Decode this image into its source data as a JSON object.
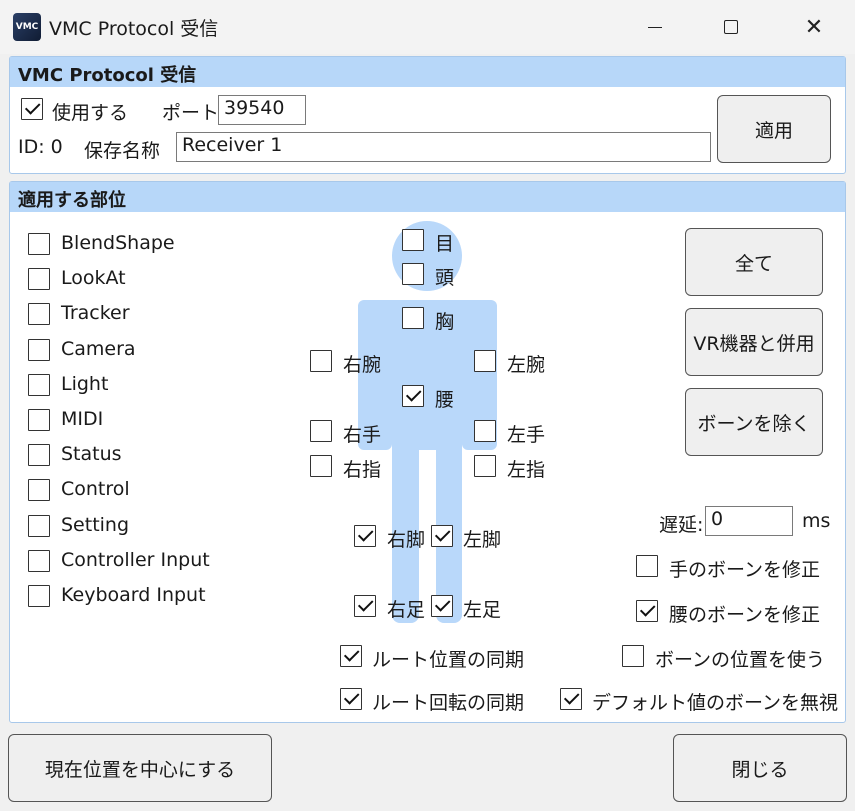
{
  "window": {
    "title": "VMC Protocol 受信",
    "icon_name": "vmc-app-icon",
    "icon_text": "VMC"
  },
  "receiver": {
    "header": "VMC Protocol 受信",
    "use_label": "使用する",
    "use_checked": true,
    "port_label": "ポート :",
    "port_value": "39540",
    "id_label": "ID: 0",
    "name_label": "保存名称",
    "name_value": "Receiver 1",
    "apply_button": "適用"
  },
  "parts": {
    "header": "適用する部位",
    "options": [
      {
        "label": "BlendShape",
        "checked": false
      },
      {
        "label": "LookAt",
        "checked": false
      },
      {
        "label": "Tracker",
        "checked": false
      },
      {
        "label": "Camera",
        "checked": false
      },
      {
        "label": "Light",
        "checked": false
      },
      {
        "label": "MIDI",
        "checked": false
      },
      {
        "label": "Status",
        "checked": false
      },
      {
        "label": "Control",
        "checked": false
      },
      {
        "label": "Setting",
        "checked": false
      },
      {
        "label": "Controller Input",
        "checked": false
      },
      {
        "label": "Keyboard Input",
        "checked": false
      }
    ],
    "body": {
      "eye": {
        "label": "目",
        "checked": false
      },
      "head": {
        "label": "頭",
        "checked": false
      },
      "chest": {
        "label": "胸",
        "checked": false
      },
      "right_arm": {
        "label": "右腕",
        "checked": false
      },
      "left_arm": {
        "label": "左腕",
        "checked": false
      },
      "waist": {
        "label": "腰",
        "checked": true
      },
      "right_hand": {
        "label": "右手",
        "checked": false
      },
      "left_hand": {
        "label": "左手",
        "checked": false
      },
      "right_finger": {
        "label": "右指",
        "checked": false
      },
      "left_finger": {
        "label": "左指",
        "checked": false
      },
      "right_leg": {
        "label": "右脚",
        "checked": true
      },
      "left_leg": {
        "label": "左脚",
        "checked": true
      },
      "right_foot": {
        "label": "右足",
        "checked": true
      },
      "left_foot": {
        "label": "左足",
        "checked": true
      }
    },
    "root_pos_sync": {
      "label": "ルート位置の同期",
      "checked": true
    },
    "root_rot_sync": {
      "label": "ルート回転の同期",
      "checked": true
    },
    "buttons": {
      "all": "全て",
      "with_vr": "VR機器と併用",
      "except_bones": "ボーンを除く"
    },
    "delay": {
      "label": "遅延:",
      "value": "0",
      "unit": "ms"
    },
    "fix_hand_bones": {
      "label": "手のボーンを修正",
      "checked": false
    },
    "fix_waist_bones": {
      "label": "腰のボーンを修正",
      "checked": true
    },
    "use_bone_positions": {
      "label": "ボーンの位置を使う",
      "checked": false
    },
    "ignore_default_bones": {
      "label": "デフォルト値のボーンを無視",
      "checked": true
    }
  },
  "footer": {
    "center_button": "現在位置を中心にする",
    "close_button": "閉じる"
  }
}
